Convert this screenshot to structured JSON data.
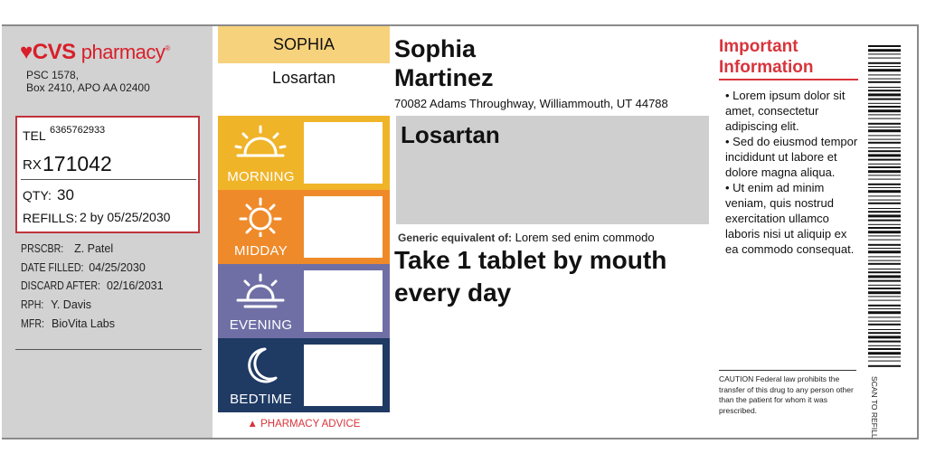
{
  "pharmacy": {
    "logo_symbol": "♥",
    "logo_brand": "CVS",
    "logo_text": "pharmacy",
    "logo_tm": "®",
    "address_line1": "PSC 1578,",
    "address_line2": "Box 2410, APO AA 02400"
  },
  "rx_box": {
    "tel_label": "TEL",
    "tel": "6365762933",
    "rx_label": "RX",
    "rx_number": "171042",
    "qty_label": "QTY:",
    "qty": "30",
    "refills_label": "REFILLS:",
    "refills": "2 by 05/25/2030"
  },
  "details": [
    {
      "label": "PRSCBR:",
      "value": "Z. Patel"
    },
    {
      "label": "DATE FILLED:",
      "value": "04/25/2030"
    },
    {
      "label": "DISCARD AFTER:",
      "value": "02/16/2031"
    },
    {
      "label": "RPH:",
      "value": "Y. Davis"
    },
    {
      "label": "MFR:",
      "value": "BioVita Labs"
    }
  ],
  "schedule": {
    "patient_first": "SOPHIA",
    "drug": "Losartan",
    "slots": [
      {
        "label": "MORNING",
        "color": "#f0b429",
        "icon": "sunrise-icon"
      },
      {
        "label": "MIDDAY",
        "color": "#ef8a2a",
        "icon": "sun-icon"
      },
      {
        "label": "EVENING",
        "color": "#6f6fa6",
        "icon": "sunset-icon"
      },
      {
        "label": "BEDTIME",
        "color": "#1f3a63",
        "icon": "moon-icon"
      }
    ],
    "advice": "▲ PHARMACY ADVICE"
  },
  "patient": {
    "first": "Sophia",
    "last": "Martinez",
    "address": "70082 Adams Throughway, Williammouth, UT 44788"
  },
  "medication": {
    "name": "Losartan",
    "generic_label": "Generic equivalent of:",
    "generic_value": "Lorem sed enim commodo",
    "sig_line1": "Take 1 tablet by mouth",
    "sig_line2": "every day"
  },
  "important": {
    "title_line1": "Important",
    "title_line2": "Information",
    "bullets": [
      "• Lorem ipsum dolor sit amet, consectetur adipiscing elit.",
      "• Sed do eiusmod tempor incididunt ut labore et dolore magna aliqua.",
      "• Ut enim ad minim veniam, quis nostrud exercitation ullamco laboris nisi ut aliquip ex ea commodo consequat."
    ],
    "caution": "CAUTION Federal law prohibits the transfer of this drug to any person other than the patient for whom it was prescribed."
  },
  "scan_text": "SCAN TO REFILL",
  "colors": {
    "brand_red": "#d81f2a",
    "accent_red": "#d8343c",
    "name_bar": "#f7d27c"
  }
}
